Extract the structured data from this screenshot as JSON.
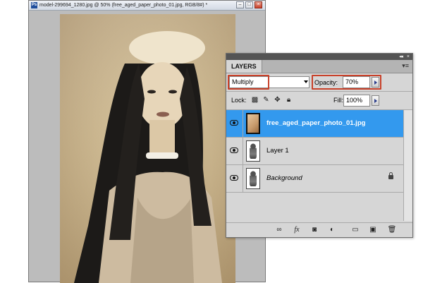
{
  "document": {
    "title": "model-299694_1280.jpg @ 50% (free_aged_paper_photo_01.jpg, RGB/8#) *",
    "app_icon": "Ps"
  },
  "window_buttons": {
    "minimize": "–",
    "maximize": "□",
    "close": "×"
  },
  "layers_panel": {
    "tab_label": "LAYERS",
    "collapse_icon": "collapse-icon",
    "blend_mode": "Multiply",
    "opacity_label": "Opacity:",
    "opacity_value": "70%",
    "lock_label": "Lock:",
    "fill_label": "Fill:",
    "fill_value": "100%",
    "layers": [
      {
        "name": "free_aged_paper_photo_01.jpg",
        "selected": true,
        "visible": true
      },
      {
        "name": "Layer 1",
        "selected": false,
        "visible": true
      },
      {
        "name": "Background",
        "selected": false,
        "visible": true,
        "locked": true
      }
    ],
    "bottom_icons": [
      "link-icon",
      "fx-icon",
      "mask-icon",
      "adjustment-icon",
      "folder-icon",
      "new-layer-icon",
      "trash-icon"
    ]
  },
  "colors": {
    "selected_row": "#3399ee",
    "highlight_box": "#c8412a"
  }
}
